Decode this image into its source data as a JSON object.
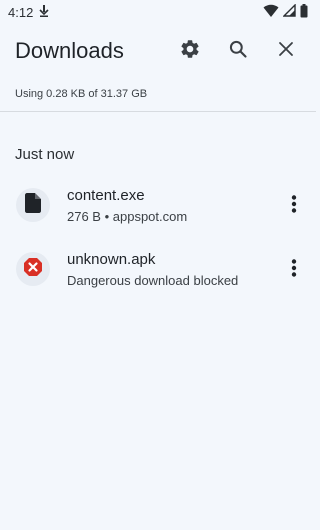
{
  "status_bar": {
    "time": "4:12"
  },
  "header": {
    "title": "Downloads",
    "icons": [
      "gear-icon",
      "search-icon",
      "close-icon"
    ]
  },
  "storage": {
    "text": "Using 0.28 KB of 31.37 GB"
  },
  "section": {
    "title": "Just now"
  },
  "downloads": [
    {
      "name": "content.exe",
      "meta": "276 B • appspot.com",
      "icon": "file-icon"
    },
    {
      "name": "unknown.apk",
      "meta": "Dangerous download blocked",
      "icon": "blocked-icon"
    }
  ],
  "colors": {
    "background": "#f3f7fc",
    "blocked_red": "#d93025",
    "icon_dark": "#1f2328"
  }
}
